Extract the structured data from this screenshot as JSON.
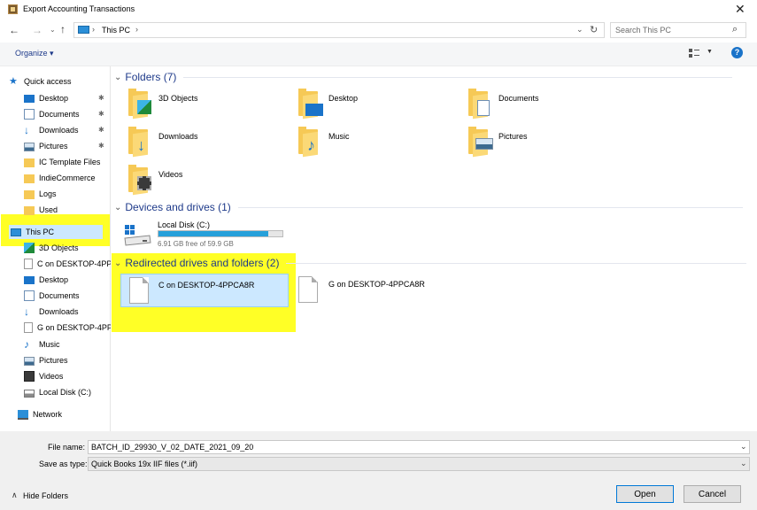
{
  "window": {
    "title": "Export Accounting Transactions"
  },
  "address": {
    "breadcrumb": "This PC",
    "search_placeholder": "Search This PC"
  },
  "toolbar": {
    "organize_label": "Organize ▾"
  },
  "sidebar": {
    "quick_access": "Quick access",
    "quick_items": [
      "Desktop",
      "Documents",
      "Downloads",
      "Pictures",
      "IC Template Files",
      "IndieCommerce",
      "Logs",
      "Used"
    ],
    "this_pc": "This PC",
    "pc_items": [
      "3D Objects",
      "C on DESKTOP-4PP",
      "Desktop",
      "Documents",
      "Downloads",
      "G on DESKTOP-4PP",
      "Music",
      "Pictures",
      "Videos",
      "Local Disk (C:)"
    ],
    "network": "Network"
  },
  "main": {
    "folders_header": "Folders (7)",
    "folders": [
      "3D Objects",
      "Desktop",
      "Documents",
      "Downloads",
      "Music",
      "Pictures",
      "Videos"
    ],
    "devices_header": "Devices and drives (1)",
    "drive": {
      "name": "Local Disk (C:)",
      "free": "6.91 GB free of 59.9 GB",
      "used_fraction": 0.885
    },
    "redirected_header": "Redirected drives and folders (2)",
    "redirected": [
      "C on DESKTOP-4PPCA8R",
      "G on DESKTOP-4PPCA8R"
    ]
  },
  "bottom": {
    "filename_label": "File name:",
    "filename_value": "BATCH_ID_29930_V_02_DATE_2021_09_20",
    "savetype_label": "Save as type:",
    "savetype_value": "Quick Books 19x IIF files (*.iif)",
    "hide_folders": "Hide Folders",
    "open_label": "Open",
    "cancel_label": "Cancel"
  },
  "colors": {
    "accent": "#0078d7",
    "highlight": "#ffff00",
    "selection": "#cce8ff"
  }
}
